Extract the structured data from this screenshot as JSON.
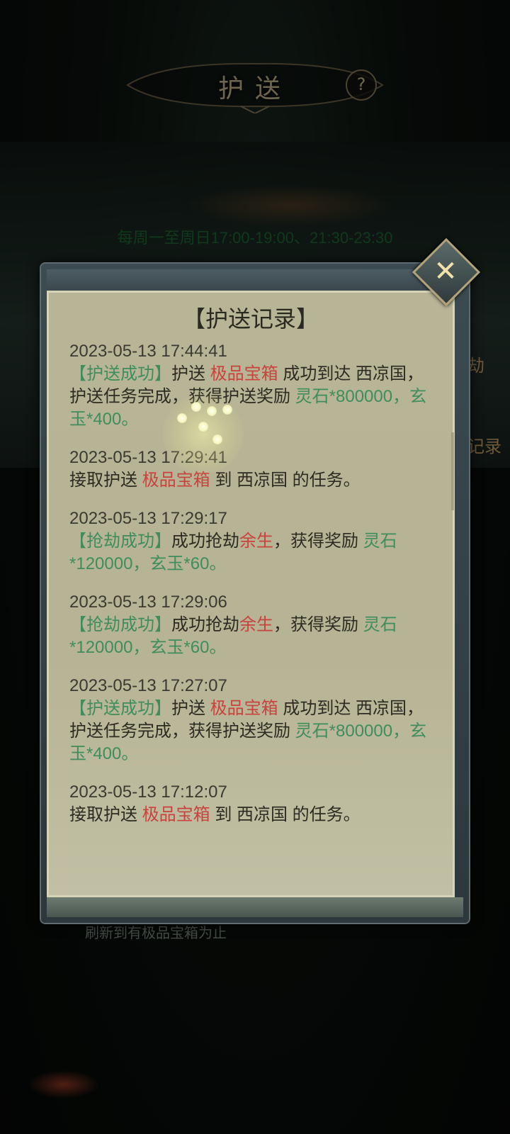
{
  "header": {
    "title": "护送",
    "help_icon": "?",
    "schedule": "每周一至周日17:00-19:00、21:30-23:30"
  },
  "side_buttons": {
    "rob_fragment": "劫",
    "record_fragment": "记录"
  },
  "refresh_option": "刷新到有极品宝箱为止",
  "modal": {
    "title": "【护送记录】",
    "close_icon": "✕",
    "records": [
      {
        "time": "2023-05-13  17:44:41",
        "tag": "【护送成功】",
        "p1": "护送",
        "item": "极品宝箱",
        "p2": "成功到达 西凉国，",
        "p3": "护送任务完成，获得护送奖励",
        "reward_a": "灵石*800000，玄",
        "reward_b": "玉*400。"
      },
      {
        "time": "2023-05-13  17:29:41",
        "p1": "接取护送",
        "item": "极品宝箱",
        "p2": "到 西凉国 的任务。"
      },
      {
        "time": "2023-05-13  17:29:17",
        "tag": "【抢劫成功】",
        "p1": "成功抢劫",
        "target": "余生",
        "p2": "，获得奖励",
        "reward_a": "灵石",
        "reward_b": "*120000，玄玉*60。"
      },
      {
        "time": "2023-05-13  17:29:06",
        "tag": "【抢劫成功】",
        "p1": "成功抢劫",
        "target": "余生",
        "p2": "，获得奖励",
        "reward_a": "灵石",
        "reward_b": "*120000，玄玉*60。"
      },
      {
        "time": "2023-05-13  17:27:07",
        "tag": "【护送成功】",
        "p1": "护送",
        "item": "极品宝箱",
        "p2": "成功到达 西凉国，",
        "p3": "护送任务完成，获得护送奖励",
        "reward_a": "灵石*800000，玄",
        "reward_b": "玉*400。"
      },
      {
        "time": "2023-05-13  17:12:07",
        "p1": "接取护送",
        "item": "极品宝箱",
        "p2": "到 西凉国 的任务。"
      }
    ]
  },
  "colors": {
    "success_green": "#3f8d5c",
    "highlight_red": "#c8433d",
    "panel_bg": "#b7b596"
  }
}
